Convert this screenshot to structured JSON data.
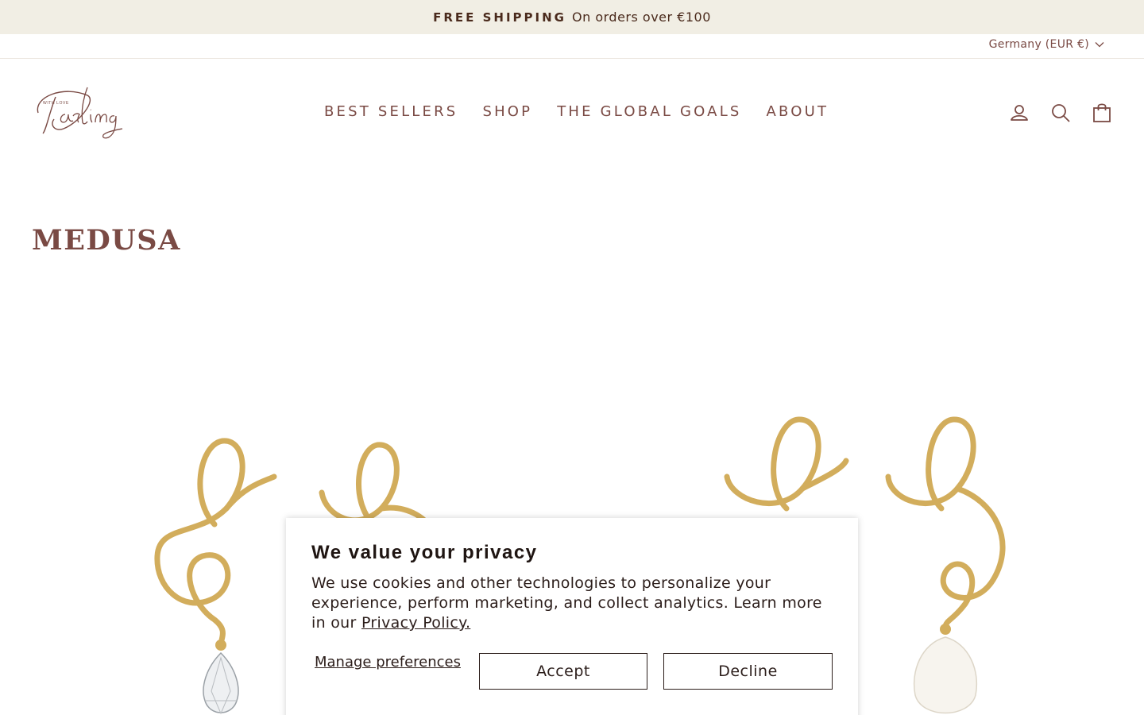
{
  "announcement": {
    "strong": "FREE SHIPPING",
    "rest": "On orders over €100"
  },
  "locale": {
    "label": "Germany (EUR €)"
  },
  "logo": {
    "script_text": "Darling",
    "small_text": "WITH LOVE"
  },
  "nav": {
    "items": [
      {
        "label": "BEST SELLERS"
      },
      {
        "label": "SHOP"
      },
      {
        "label": "THE GLOBAL GOALS"
      },
      {
        "label": "ABOUT"
      }
    ]
  },
  "header_icons": [
    "account-icon",
    "search-icon",
    "bag-icon"
  ],
  "page": {
    "title": "MEDUSA"
  },
  "products": [
    {
      "image": "medusa-earrings-diamond-drop"
    },
    {
      "image": "medusa-earrings-pearl-drop"
    }
  ],
  "cookie": {
    "title": "We value your privacy",
    "body": "We use cookies and other technologies to personalize your experience, perform marketing, and collect analytics. Learn more in our",
    "link": "Privacy Policy.",
    "manage": "Manage preferences",
    "accept": "Accept",
    "decline": "Decline"
  },
  "colors": {
    "brand": "#7a4a44",
    "announcement_bg": "#f1eee4",
    "gold": "#d2ad5c",
    "text_dark": "#2b1d1a"
  }
}
